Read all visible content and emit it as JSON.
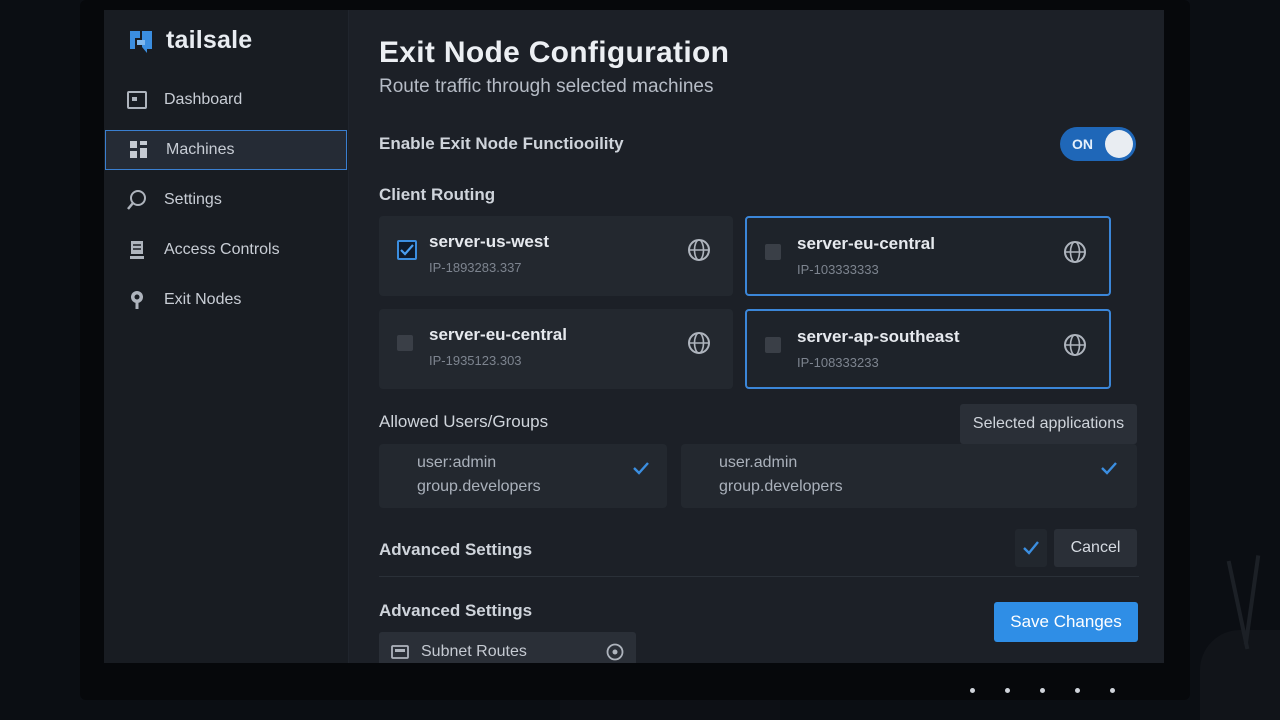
{
  "app": {
    "name": "tailsale"
  },
  "sidebar": {
    "items": [
      {
        "label": "Dashboard",
        "icon": "dashboard-icon"
      },
      {
        "label": "Machines",
        "icon": "grid-icon",
        "active": true
      },
      {
        "label": "Settings",
        "icon": "search-icon"
      },
      {
        "label": "Access Controls",
        "icon": "server-icon"
      },
      {
        "label": "Exit Nodes",
        "icon": "location-pin-icon"
      }
    ]
  },
  "main": {
    "title": "Exit Node Configuration",
    "subtitle": "Route traffic through selected machines",
    "enable_label": "Enable Exit Node Functiooility",
    "toggle": {
      "label": "ON",
      "state": "on"
    },
    "client_routing_label": "Client Routing",
    "machines": [
      {
        "name": "server-us-west",
        "ip": "IP-1893283.337",
        "checked": true,
        "selected": false
      },
      {
        "name": "server-eu-central",
        "ip": "IP-103333333",
        "checked": false,
        "selected": true
      },
      {
        "name": "server-eu-central",
        "ip": "IP-1935123.303",
        "checked": false,
        "selected": false
      },
      {
        "name": "server-ap-southeast",
        "ip": "IP-108333233",
        "checked": false,
        "selected": true
      }
    ],
    "allowed_label": "Allowed Users/Groups",
    "selected_apps_label": "Selected applications",
    "user_groups": [
      {
        "line1": "user:admin",
        "line2": "group.developers"
      },
      {
        "line1": "user.admin",
        "line2": "group.developers"
      }
    ],
    "advanced_label_1": "Advanced Settings",
    "cancel_label": "Cancel",
    "advanced_label_2": "Advanced Settings",
    "save_label": "Save Changes",
    "subnet_label": "Subnet Routes"
  },
  "colors": {
    "accent": "#2f8ee6",
    "toggle_on": "#1f67b8",
    "selected_border": "#3b86d8"
  }
}
